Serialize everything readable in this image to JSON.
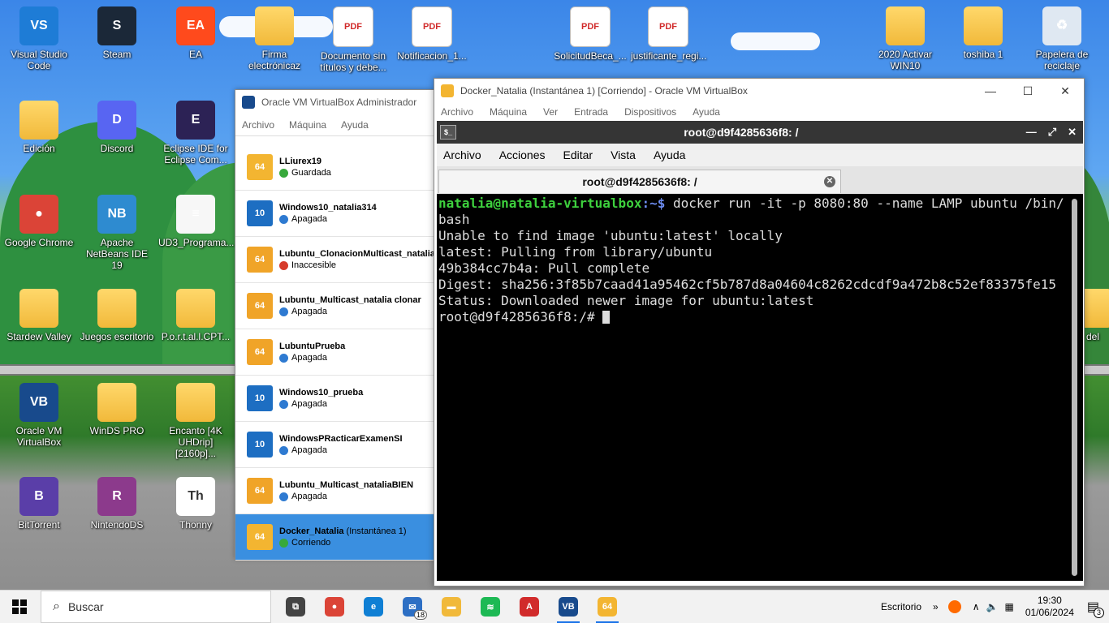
{
  "desktop": {
    "icons": [
      {
        "label": "Visual Studio Code",
        "icon": "vscode-icon",
        "color": "#1e7cd6",
        "glyph": "VS"
      },
      {
        "label": "Steam",
        "icon": "steam-icon",
        "color": "#1b2838",
        "glyph": "S"
      },
      {
        "label": "EA",
        "icon": "ea-icon",
        "color": "#ff4a1c",
        "glyph": "EA"
      },
      {
        "label": "Firma electrónicaz",
        "icon": "folder-icon",
        "color": "#f1b93a",
        "glyph": ""
      },
      {
        "label": "Documento sin títulos y debe...",
        "icon": "pdf-icon",
        "color": "#ffffff",
        "glyph": "PDF"
      },
      {
        "label": "Notificacion_1...",
        "icon": "pdf-icon",
        "color": "#ffffff",
        "glyph": "PDF"
      },
      {
        "label": "SolicitudBeca_...",
        "icon": "pdf-icon",
        "color": "#ffffff",
        "glyph": "PDF"
      },
      {
        "label": "justificante_regi...",
        "icon": "pdf-icon",
        "color": "#ffffff",
        "glyph": "PDF"
      },
      {
        "label": "2020 Activar WIN10",
        "icon": "folder-icon",
        "color": "#f1b93a",
        "glyph": ""
      },
      {
        "label": "toshiba 1",
        "icon": "folder-icon",
        "color": "#f1b93a",
        "glyph": ""
      },
      {
        "label": "Papelera de reciclaje",
        "icon": "recycle-bin-icon",
        "color": "#dfe8f2",
        "glyph": "♻"
      },
      {
        "label": "Edición",
        "icon": "folder-icon",
        "color": "#f1b93a",
        "glyph": ""
      },
      {
        "label": "Discord",
        "icon": "discord-icon",
        "color": "#5865f2",
        "glyph": "D"
      },
      {
        "label": "Eclipse IDE for Eclipse Com...",
        "icon": "eclipse-icon",
        "color": "#2c2255",
        "glyph": "E"
      },
      {
        "label": "Google Chrome",
        "icon": "chrome-icon",
        "color": "#db4437",
        "glyph": "●"
      },
      {
        "label": "Apache NetBeans IDE 19",
        "icon": "netbeans-icon",
        "color": "#2e8bd0",
        "glyph": "NB"
      },
      {
        "label": "UD3_Programa...",
        "icon": "document-icon",
        "color": "#f7f7f7",
        "glyph": "≡"
      },
      {
        "label": "Stardew Valley",
        "icon": "folder-icon",
        "color": "#f1b93a",
        "glyph": ""
      },
      {
        "label": "Juegos escritorio",
        "icon": "folder-icon",
        "color": "#f1b93a",
        "glyph": ""
      },
      {
        "label": "P.o.r.t.al.l.CPT...",
        "icon": "folder-icon",
        "color": "#f1b93a",
        "glyph": ""
      },
      {
        "label": "Oracle VM VirtualBox",
        "icon": "virtualbox-icon",
        "color": "#184a8c",
        "glyph": "VB"
      },
      {
        "label": "WinDS PRO",
        "icon": "folder-icon",
        "color": "#f1b93a",
        "glyph": ""
      },
      {
        "label": "Encanto [4K UHDrip][2160p]...",
        "icon": "folder-icon",
        "color": "#f1b93a",
        "glyph": ""
      },
      {
        "label": "BitTorrent",
        "icon": "bittorrent-icon",
        "color": "#5a3ea8",
        "glyph": "B"
      },
      {
        "label": "NintendoDS",
        "icon": "winrar-icon",
        "color": "#8c3a8c",
        "glyph": "R"
      },
      {
        "label": "Thonny",
        "icon": "thonny-icon",
        "color": "#ffffff",
        "glyph": "Th"
      },
      {
        "label": "del",
        "icon": "folder-icon",
        "color": "#f1b93a",
        "glyph": ""
      }
    ]
  },
  "vbox_manager": {
    "title": "Oracle VM VirtualBox Administrador",
    "menu": [
      "Archivo",
      "Máquina",
      "Ayuda"
    ],
    "vms": [
      {
        "name": "LLiurex19",
        "suffix": "",
        "state": "Guardada",
        "state_icon": "saved-icon",
        "state_color": "#37a93b",
        "os_color": "#f3b531",
        "os_glyph": "64"
      },
      {
        "name": "Windows10_natalia314",
        "suffix": "",
        "state": "Apagada",
        "state_icon": "power-off-icon",
        "state_color": "#2e7ad1",
        "os_color": "#1d6ec2",
        "os_glyph": "10"
      },
      {
        "name": "Lubuntu_ClonacionMulticast_natalia",
        "suffix": "",
        "state": "Inaccesible",
        "state_icon": "error-icon",
        "state_color": "#d63a2a",
        "os_color": "#f0a428",
        "os_glyph": "64"
      },
      {
        "name": "Lubuntu_Multicast_natalia clonar",
        "suffix": "",
        "state": "Apagada",
        "state_icon": "power-off-icon",
        "state_color": "#2e7ad1",
        "os_color": "#f0a428",
        "os_glyph": "64"
      },
      {
        "name": "LubuntuPrueba",
        "suffix": "",
        "state": "Apagada",
        "state_icon": "power-off-icon",
        "state_color": "#2e7ad1",
        "os_color": "#f0a428",
        "os_glyph": "64"
      },
      {
        "name": "Windows10_prueba",
        "suffix": "",
        "state": "Apagada",
        "state_icon": "power-off-icon",
        "state_color": "#2e7ad1",
        "os_color": "#1d6ec2",
        "os_glyph": "10"
      },
      {
        "name": "WindowsPRacticarExamenSI",
        "suffix": "",
        "state": "Apagada",
        "state_icon": "power-off-icon",
        "state_color": "#2e7ad1",
        "os_color": "#1d6ec2",
        "os_glyph": "10"
      },
      {
        "name": "Lubuntu_Multicast_nataliaBIEN",
        "suffix": "",
        "state": "Apagada",
        "state_icon": "power-off-icon",
        "state_color": "#2e7ad1",
        "os_color": "#f0a428",
        "os_glyph": "64"
      },
      {
        "name": "Docker_Natalia",
        "suffix": " (Instantánea 1)",
        "state": "Corriendo",
        "state_icon": "running-icon",
        "state_color": "#37a93b",
        "os_color": "#f3b531",
        "os_glyph": "64"
      }
    ]
  },
  "vm_window": {
    "title": "Docker_Natalia (Instantánea 1) [Corriendo] - Oracle VM VirtualBox",
    "menu": [
      "Archivo",
      "Máquina",
      "Ver",
      "Entrada",
      "Dispositivos",
      "Ayuda"
    ],
    "controls": [
      "—",
      "☐",
      "✕"
    ]
  },
  "terminal": {
    "title": "root@d9f4285636f8: /",
    "menu": [
      "Archivo",
      "Acciones",
      "Editar",
      "Vista",
      "Ayuda"
    ],
    "tab_label": "root@d9f4285636f8: /",
    "prompt_user": "natalia@natalia-virtualbox",
    "prompt_path": ":~$",
    "command": " docker run -it -p 8080:80 --name LAMP ubuntu /bin/bash",
    "output": [
      "Unable to find image 'ubuntu:latest' locally",
      "latest: Pulling from library/ubuntu",
      "49b384cc7b4a: Pull complete",
      "Digest: sha256:3f85b7caad41a95462cf5b787d8a04604c8262cdcdf9a472b8c52ef83375fe15",
      "Status: Downloaded newer image for ubuntu:latest"
    ],
    "root_prompt": "root@d9f4285636f8:/# "
  },
  "taskbar": {
    "search_placeholder": "Buscar",
    "apps": [
      {
        "icon": "task-view-icon",
        "color": "#444444",
        "glyph": "⧉"
      },
      {
        "icon": "chrome-icon",
        "color": "#db4437",
        "glyph": "●"
      },
      {
        "icon": "edge-icon",
        "color": "#0f7fd4",
        "glyph": "e"
      },
      {
        "icon": "mail-icon",
        "color": "#2d6fc4",
        "glyph": "✉"
      },
      {
        "icon": "file-explorer-icon",
        "color": "#f1b93a",
        "glyph": "▬"
      },
      {
        "icon": "spotify-icon",
        "color": "#1db954",
        "glyph": "≋"
      },
      {
        "icon": "acrobat-icon",
        "color": "#d12b2b",
        "glyph": "A"
      },
      {
        "icon": "virtualbox-icon",
        "color": "#184a8c",
        "glyph": "VB"
      },
      {
        "icon": "virtualbox-vm-icon",
        "color": "#f3b531",
        "glyph": "64"
      }
    ],
    "mail_badge": "18",
    "desktop_label": "Escritorio",
    "time": "19:30",
    "date": "01/06/2024",
    "notifications": "3"
  }
}
